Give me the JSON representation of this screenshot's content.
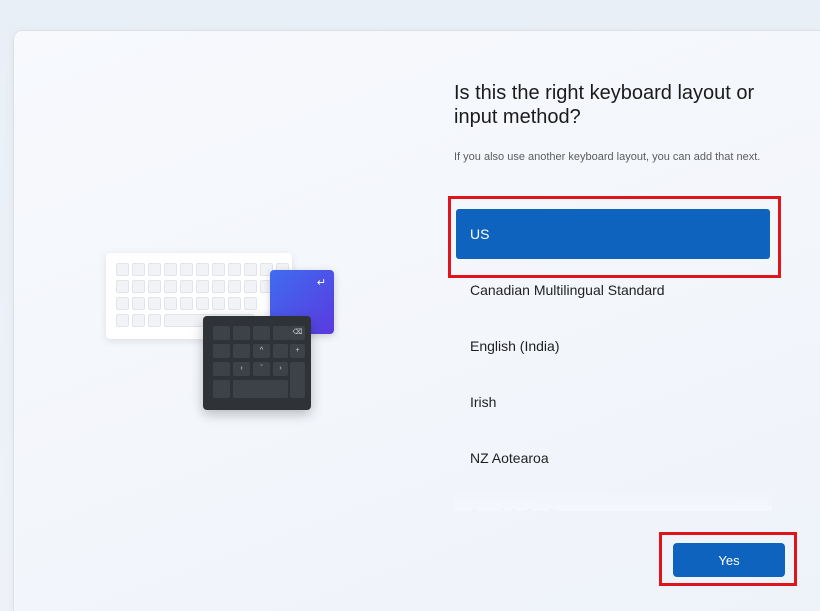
{
  "dialog": {
    "title": "Is this the right keyboard layout or input method?",
    "subtitle": "If you also use another keyboard layout, you can add that next."
  },
  "layouts": {
    "selected_index": 0,
    "items": [
      {
        "label": "US",
        "selected": true
      },
      {
        "label": "Canadian Multilingual Standard",
        "selected": false
      },
      {
        "label": "English (India)",
        "selected": false
      },
      {
        "label": "Irish",
        "selected": false
      },
      {
        "label": "NZ Aotearoa",
        "selected": false
      },
      {
        "label": "Scottish Gaelic",
        "selected": false
      }
    ]
  },
  "actions": {
    "yes_label": "Yes"
  },
  "illustration": {
    "numpad_keys": [
      "⌫",
      "^",
      "+",
      "‹",
      "ˇ",
      "›"
    ],
    "enter_key": "↵"
  },
  "colors": {
    "accent": "#0e63bf",
    "highlight": "#e0141b"
  }
}
